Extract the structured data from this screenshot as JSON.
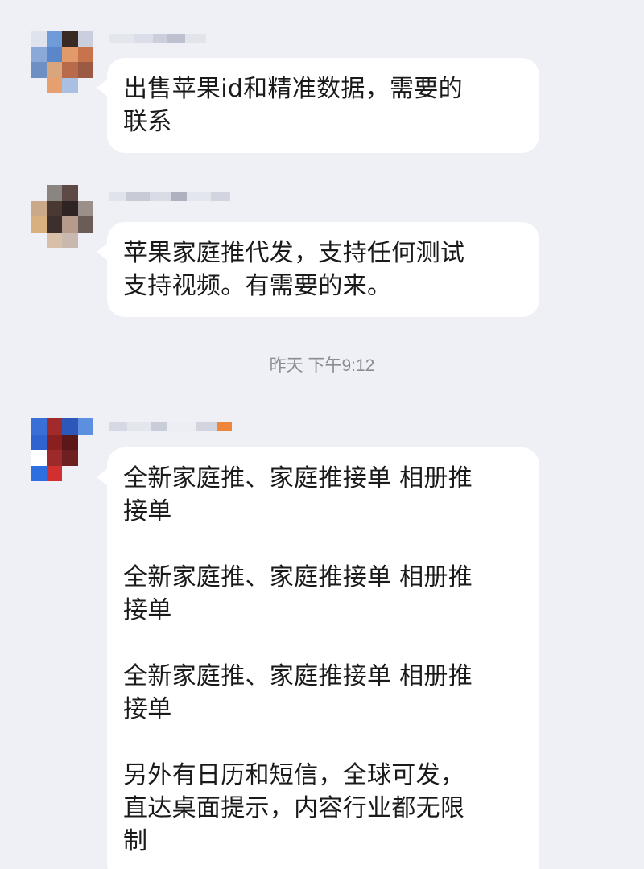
{
  "messages": [
    {
      "lines": [
        "出售苹果id和精准数据，需要的",
        "联系"
      ]
    },
    {
      "lines": [
        "苹果家庭推代发，支持任何测试",
        "支持视频。有需要的来。"
      ]
    },
    {
      "paragraphs": [
        [
          "全新家庭推、家庭推接单 相册推",
          "接单"
        ],
        [
          "全新家庭推、家庭推接单 相册推",
          "接单"
        ],
        [
          "全新家庭推、家庭推接单 相册推",
          "接单"
        ],
        [
          "另外有日历和短信，全球可发，",
          "直达桌面提示，内容行业都无限",
          "制"
        ]
      ]
    }
  ],
  "timestamp": "昨天 下午9:12",
  "colors": {
    "background": "#eef0f6",
    "bubble": "#ffffff",
    "text": "#1a1a1a",
    "timestamp": "#8a8c93"
  }
}
